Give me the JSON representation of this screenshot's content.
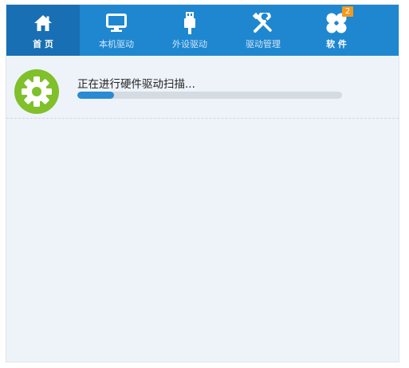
{
  "colors": {
    "nav_bg": "#1f87d0",
    "nav_active_bg": "#186fb3",
    "content_bg": "#eef3f9",
    "accent": "#2a8ad2",
    "gear": "#7fc02b",
    "badge": "#f39a1e"
  },
  "nav": {
    "items": [
      {
        "label": "首 页",
        "icon": "home-icon"
      },
      {
        "label": "本机驱动",
        "icon": "monitor-icon"
      },
      {
        "label": "外设驱动",
        "icon": "usb-icon"
      },
      {
        "label": "驱动管理",
        "icon": "tools-icon"
      },
      {
        "label": "软 件",
        "icon": "software-icon",
        "badge": "2"
      }
    ],
    "active_index": 0
  },
  "scan": {
    "icon": "gear-icon",
    "status_text": "正在进行硬件驱动扫描...",
    "progress_fraction": 0.14
  }
}
